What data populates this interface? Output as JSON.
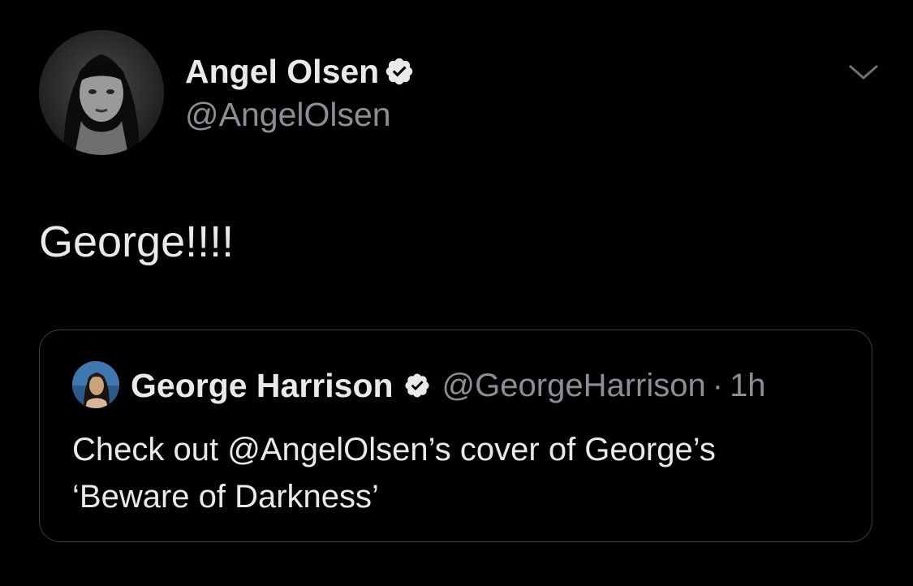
{
  "author": {
    "name": "Angel Olsen",
    "handle": "@AngelOlsen",
    "verified": true,
    "avatar_icon": "avatar-photo-icon"
  },
  "tweet": {
    "text": "George!!!!"
  },
  "quoted_tweet": {
    "author_name": "George Harrison",
    "author_handle": "@GeorgeHarrison",
    "verified": true,
    "separator": "·",
    "time": "1h",
    "text_lines": [
      "Check out @AngelOlsen’s cover of George’s",
      "‘Beware of Darkness’"
    ]
  },
  "icons": {
    "verified": "verified-badge-icon",
    "more": "chevron-down-icon"
  },
  "colors": {
    "background": "#000000",
    "primary_text": "#e7e9ea",
    "secondary_text": "#8b8f94",
    "border": "#3a3d40",
    "verified_badge": "#e7e9ea"
  }
}
